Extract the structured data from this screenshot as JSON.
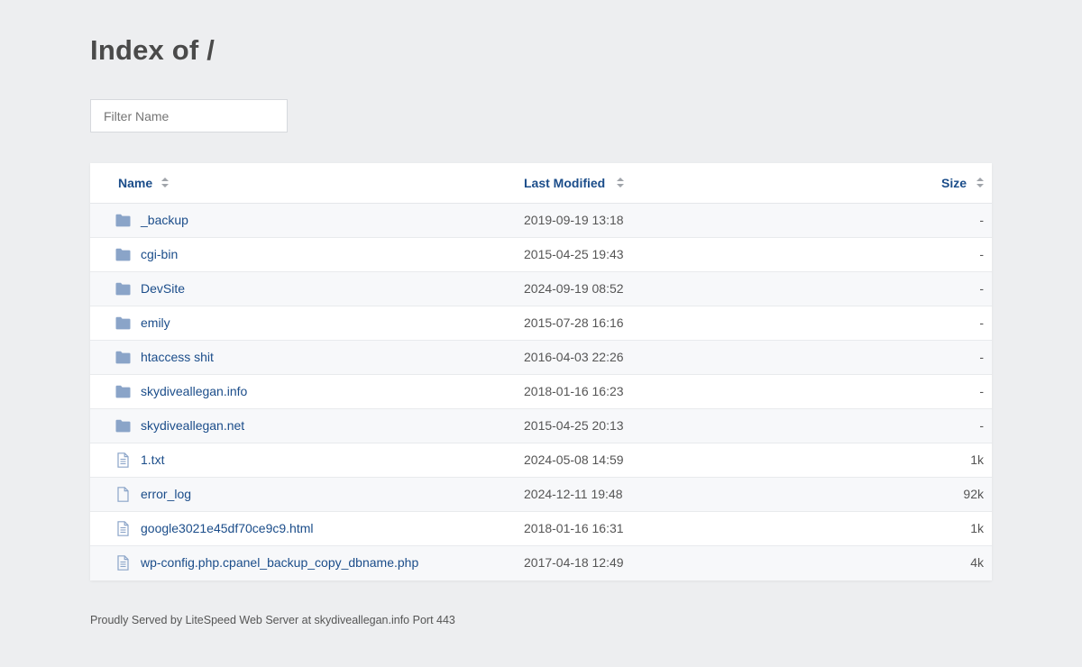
{
  "page": {
    "title": "Index of /",
    "filter_placeholder": "Filter Name",
    "footer": "Proudly Served by LiteSpeed Web Server at skydiveallegan.info Port 443"
  },
  "columns": {
    "name": "Name",
    "modified": "Last Modified",
    "size": "Size"
  },
  "colors": {
    "link": "#1b4d8a",
    "folder_icon": "#8aa4c8",
    "file_icon": "#8aa4c8",
    "background": "#edeef0"
  },
  "entries": [
    {
      "type": "folder",
      "icon": "folder-icon",
      "name": "_backup",
      "modified": "2019-09-19 13:18",
      "size": "-"
    },
    {
      "type": "folder",
      "icon": "folder-icon",
      "name": "cgi-bin",
      "modified": "2015-04-25 19:43",
      "size": "-"
    },
    {
      "type": "folder",
      "icon": "folder-icon",
      "name": "DevSite",
      "modified": "2024-09-19 08:52",
      "size": "-"
    },
    {
      "type": "folder",
      "icon": "folder-icon",
      "name": "emily",
      "modified": "2015-07-28 16:16",
      "size": "-"
    },
    {
      "type": "folder",
      "icon": "folder-icon",
      "name": "htaccess shit",
      "modified": "2016-04-03 22:26",
      "size": "-"
    },
    {
      "type": "folder",
      "icon": "folder-icon",
      "name": "skydiveallegan.info",
      "modified": "2018-01-16 16:23",
      "size": "-"
    },
    {
      "type": "folder",
      "icon": "folder-icon",
      "name": "skydiveallegan.net",
      "modified": "2015-04-25 20:13",
      "size": "-"
    },
    {
      "type": "text",
      "icon": "text-file-icon",
      "name": "1.txt",
      "modified": "2024-05-08 14:59",
      "size": "1k"
    },
    {
      "type": "blank",
      "icon": "file-icon",
      "name": "error_log",
      "modified": "2024-12-11 19:48",
      "size": "92k"
    },
    {
      "type": "text",
      "icon": "text-file-icon",
      "name": "google3021e45df70ce9c9.html",
      "modified": "2018-01-16 16:31",
      "size": "1k"
    },
    {
      "type": "text",
      "icon": "text-file-icon",
      "name": "wp-config.php.cpanel_backup_copy_dbname.php",
      "modified": "2017-04-18 12:49",
      "size": "4k"
    }
  ]
}
